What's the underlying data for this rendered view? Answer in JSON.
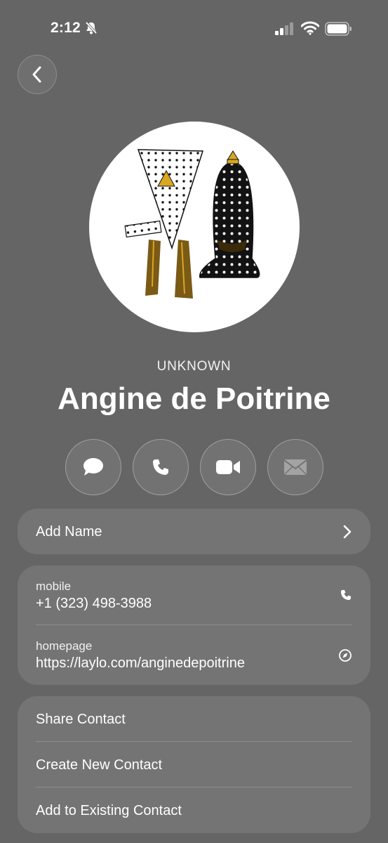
{
  "status_bar": {
    "time": "2:12",
    "icons": [
      "bell-slash-icon",
      "signal-icon",
      "wifi-icon",
      "battery-icon"
    ]
  },
  "header": {
    "back_icon": "chevron-left-icon"
  },
  "contact": {
    "subtitle": "UNKNOWN",
    "name": "Angine de Poitrine"
  },
  "actions": [
    {
      "name": "message",
      "icon": "message-bubble-icon",
      "enabled": true
    },
    {
      "name": "call",
      "icon": "phone-icon",
      "enabled": true
    },
    {
      "name": "video",
      "icon": "video-camera-icon",
      "enabled": true
    },
    {
      "name": "mail",
      "icon": "envelope-icon",
      "enabled": false
    }
  ],
  "add_name": {
    "label": "Add Name",
    "icon": "chevron-right-icon"
  },
  "details": {
    "mobile": {
      "label": "mobile",
      "value": "+1 (323) 498-3988",
      "icon": "phone-icon"
    },
    "homepage": {
      "label": "homepage",
      "value": "https://laylo.com/anginedepoitrine",
      "icon": "compass-icon"
    }
  },
  "options": {
    "share": "Share Contact",
    "create": "Create New Contact",
    "add_existing": "Add to Existing Contact"
  },
  "colors": {
    "background": "#656565",
    "card": "#747474",
    "text": "#ffffff",
    "avatar_accent": "#d9a721"
  }
}
